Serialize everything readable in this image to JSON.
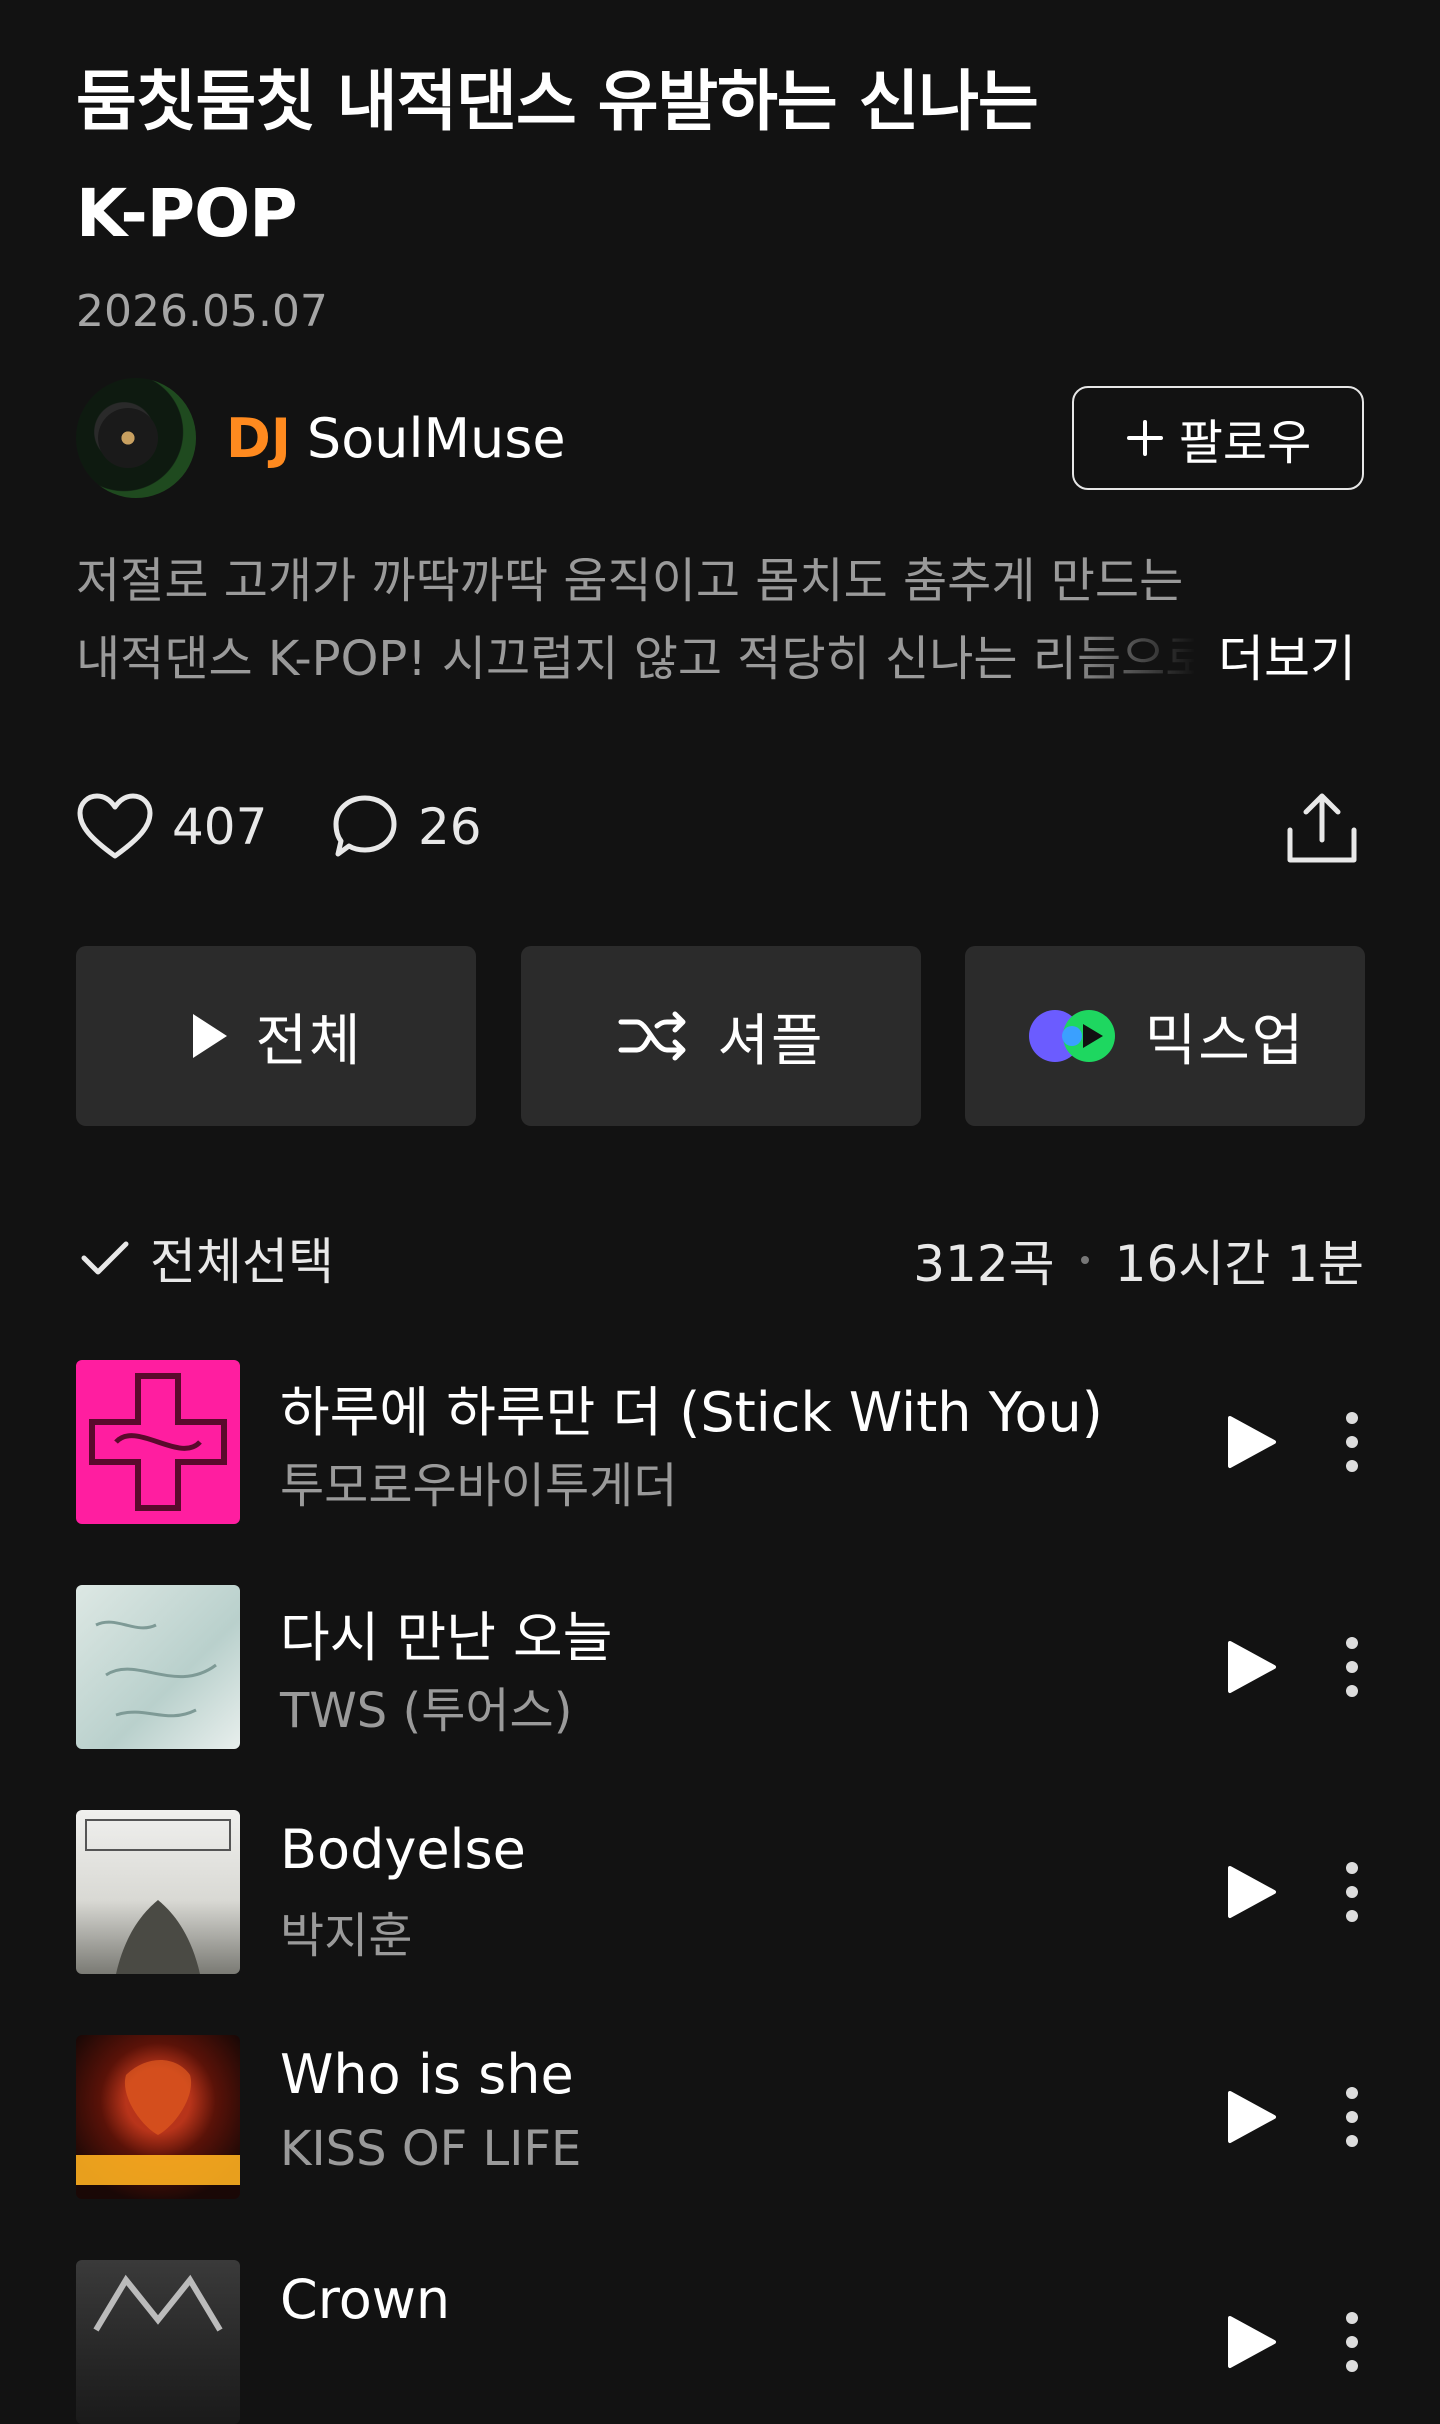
{
  "playlist": {
    "title_line1": "둠칫둠칫 내적댄스 유발하는 신나는",
    "title_line2": "K-POP",
    "date": "2026.05.07",
    "dj_tag": "DJ",
    "dj_name": "SoulMuse",
    "follow_label": "팔로우",
    "description_line1": "저절로 고개가 까딱까딱 움직이고 몸치도 춤추게 만드는",
    "description_line2": "내적댄스 K-POP! 시끄럽지 않고 적당히 신나는 리듬으로",
    "more_label": "더보기",
    "likes": "407",
    "comments": "26"
  },
  "actions": {
    "play_all": "전체",
    "shuffle": "셔플",
    "mixup": "믹스업"
  },
  "list_header": {
    "select_all": "전체선택",
    "song_count": "312곡",
    "duration": "16시간 1분"
  },
  "tracks": [
    {
      "title": "하루에 하루만 더 (Stick With You)",
      "artist": "투모로우바이투게더"
    },
    {
      "title": "다시 만난 오늘",
      "artist": "TWS (투어스)"
    },
    {
      "title": "Bodyelse",
      "artist": "박지훈"
    },
    {
      "title": "Who is she",
      "artist": "KISS OF LIFE"
    },
    {
      "title": "Crown",
      "artist": ""
    }
  ],
  "colors": {
    "background": "#121212",
    "dj_accent": "#ff8a1f",
    "button_bg": "#2b2b2b",
    "secondary_text": "#9a9a9a"
  },
  "icons": [
    "heart-icon",
    "comment-icon",
    "share-icon",
    "play-icon",
    "shuffle-icon",
    "mixup-icon",
    "check-icon",
    "more-vertical-icon",
    "plus-icon"
  ]
}
